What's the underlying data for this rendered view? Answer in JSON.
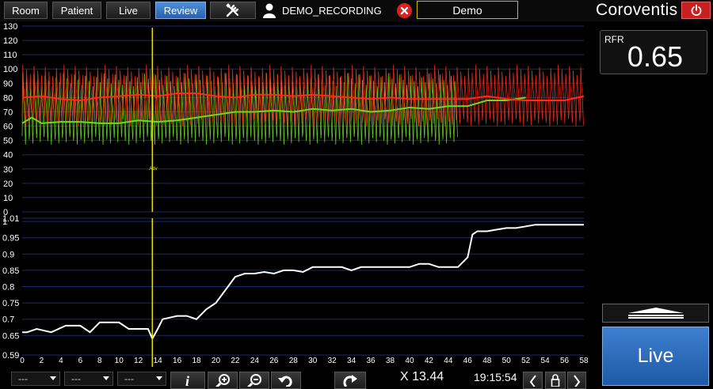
{
  "nav": {
    "tabs": [
      {
        "label": "Room",
        "active": false
      },
      {
        "label": "Patient",
        "active": false
      },
      {
        "label": "Live",
        "active": false
      },
      {
        "label": "Review",
        "active": true
      }
    ]
  },
  "header": {
    "tools_icon": "tools-icon",
    "user_icon": "user-icon",
    "recording_name": "DEMO_RECORDING",
    "close_icon": "close-icon",
    "mode": "Demo",
    "brand": "Coroventis",
    "power_icon": "power-icon"
  },
  "rfr": {
    "label": "RFR",
    "value": "0.65"
  },
  "side": {
    "collapse_icon": "collapse-panel-icon",
    "live_label": "Live"
  },
  "bottom": {
    "dropdowns": [
      "---",
      "---",
      "---"
    ],
    "icons": [
      "info-icon",
      "zoom-in-icon",
      "zoom-out-icon",
      "undo-icon",
      "redo-icon"
    ],
    "cursor_readout": "X 13.44",
    "clock": "19:15:54",
    "nav_icons": [
      "prev-icon",
      "lock-icon",
      "next-icon"
    ]
  },
  "colors": {
    "accent_blue": "#2f6fc0",
    "pa_red": "#ff2a1a",
    "pd_green": "#6add1a",
    "cursor_yellow": "#e8e000",
    "ratio_white": "#ffffff",
    "grid_blue": "#1a2a6a"
  },
  "chart_data": [
    {
      "type": "line",
      "title": "",
      "x_range": [
        0,
        58
      ],
      "y_range": [
        0,
        130
      ],
      "y_ticks": [
        0,
        10,
        20,
        30,
        40,
        50,
        60,
        70,
        80,
        90,
        100,
        110,
        120,
        130
      ],
      "cursor_x": 13.44,
      "cursor_label": "Adv",
      "series": [
        {
          "id": "pa_mean",
          "color": "#ff2a1a",
          "x": [
            0,
            2,
            4,
            6,
            8,
            10,
            12,
            14,
            16,
            18,
            20,
            22,
            24,
            26,
            28,
            30,
            32,
            34,
            36,
            38,
            40,
            42,
            44,
            46,
            48,
            50,
            52,
            54,
            56,
            58
          ],
          "y": [
            80,
            81,
            79,
            78,
            80,
            81,
            82,
            81,
            83,
            83,
            81,
            80,
            82,
            82,
            81,
            82,
            81,
            80,
            79,
            80,
            79,
            79,
            79,
            79,
            81,
            79,
            78,
            78,
            78,
            81
          ]
        },
        {
          "id": "pd_mean",
          "color": "#6add1a",
          "x": [
            0,
            1,
            2,
            4,
            6,
            8,
            10,
            12,
            14,
            16,
            18,
            20,
            22,
            24,
            26,
            28,
            30,
            32,
            34,
            36,
            38,
            40,
            42,
            44,
            46,
            48,
            50,
            52
          ],
          "y": [
            62,
            66,
            62,
            63,
            63,
            62,
            62,
            64,
            63,
            64,
            66,
            68,
            70,
            70,
            71,
            70,
            72,
            71,
            72,
            70,
            71,
            73,
            72,
            74,
            74,
            78,
            78,
            80
          ]
        },
        {
          "id": "pa_phasic",
          "color": "#ff2a1a",
          "x_range": [
            0,
            58
          ],
          "min": 60,
          "max": 103,
          "beats": 150
        },
        {
          "id": "pd_phasic",
          "color": "#6add1a",
          "x_range": [
            0,
            45
          ],
          "min": 47,
          "max": 97,
          "beats": 118
        }
      ]
    },
    {
      "type": "line",
      "title": "",
      "x_range": [
        0,
        58
      ],
      "y_range": [
        0.59,
        1.01
      ],
      "y_ticks": [
        0.59,
        0.65,
        0.7,
        0.75,
        0.8,
        0.85,
        0.9,
        0.95,
        1.0,
        1.01
      ],
      "x_ticks": [
        0,
        2,
        4,
        6,
        8,
        10,
        12,
        14,
        16,
        18,
        20,
        22,
        24,
        26,
        28,
        30,
        32,
        34,
        36,
        38,
        40,
        42,
        44,
        46,
        48,
        50,
        52,
        54,
        56,
        58
      ],
      "cursor_x": 13.44,
      "series": [
        {
          "id": "pd_pa_ratio",
          "color": "#ffffff",
          "x": [
            0,
            0.5,
            1.5,
            3,
            4.5,
            6,
            7,
            8,
            9,
            10,
            11,
            12,
            13,
            13.44,
            14,
            14.5,
            16,
            17,
            18,
            19,
            20,
            21,
            22,
            23,
            24,
            25,
            26,
            27,
            28,
            29,
            30,
            31,
            32,
            33,
            34,
            35,
            36,
            37,
            38,
            39,
            40,
            41,
            42,
            43,
            44,
            45,
            46,
            46.5,
            47,
            48,
            49,
            50,
            51,
            52,
            53,
            54,
            55,
            56,
            57,
            58
          ],
          "y": [
            0.66,
            0.66,
            0.67,
            0.66,
            0.68,
            0.68,
            0.66,
            0.69,
            0.69,
            0.69,
            0.67,
            0.67,
            0.67,
            0.64,
            0.67,
            0.7,
            0.71,
            0.71,
            0.7,
            0.73,
            0.75,
            0.79,
            0.83,
            0.84,
            0.84,
            0.845,
            0.84,
            0.85,
            0.85,
            0.845,
            0.86,
            0.86,
            0.86,
            0.86,
            0.85,
            0.86,
            0.86,
            0.86,
            0.86,
            0.86,
            0.86,
            0.87,
            0.87,
            0.86,
            0.86,
            0.86,
            0.89,
            0.96,
            0.97,
            0.97,
            0.975,
            0.98,
            0.98,
            0.985,
            0.99,
            0.99,
            0.99,
            0.99,
            0.99,
            0.99
          ]
        }
      ]
    }
  ]
}
